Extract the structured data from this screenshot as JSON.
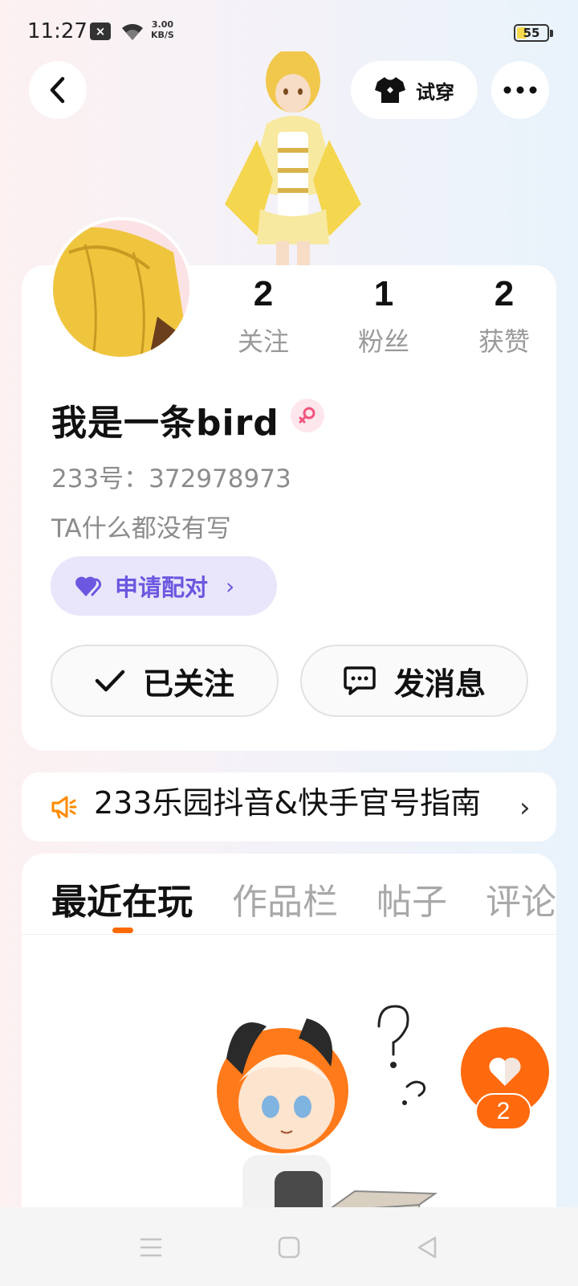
{
  "status_bar": {
    "time": "11:27",
    "notif_symbol": "×",
    "speed_value": "3.00",
    "speed_unit": "KB/S",
    "battery": "55"
  },
  "header": {
    "tryon_label": "试穿"
  },
  "profile": {
    "stats": [
      {
        "value": "2",
        "label": "关注"
      },
      {
        "value": "1",
        "label": "粉丝"
      },
      {
        "value": "2",
        "label": "获赞"
      }
    ],
    "nickname": "我是一条bird",
    "uid": "233号：372978973",
    "bio": "TA什么都没有写",
    "pair_label": "申请配对",
    "follow_label": "已关注",
    "message_label": "发消息"
  },
  "announcement": {
    "text": "233乐园抖音&快手官号指南"
  },
  "tabs": [
    {
      "label": "最近在玩",
      "active": true
    },
    {
      "label": "作品栏",
      "active": false
    },
    {
      "label": "帖子",
      "active": false
    },
    {
      "label": "评论",
      "active": false
    }
  ],
  "like": {
    "count": "2"
  },
  "colors": {
    "accent": "#ff6a00",
    "pair_text": "#6b57e0",
    "pair_bg": "#e9e6fb"
  },
  "icons": [
    "back-icon",
    "tshirt-icon",
    "more-icon",
    "female-icon",
    "heart-icon",
    "check-icon",
    "chat-icon",
    "megaphone-icon",
    "chevron-right-icon"
  ]
}
